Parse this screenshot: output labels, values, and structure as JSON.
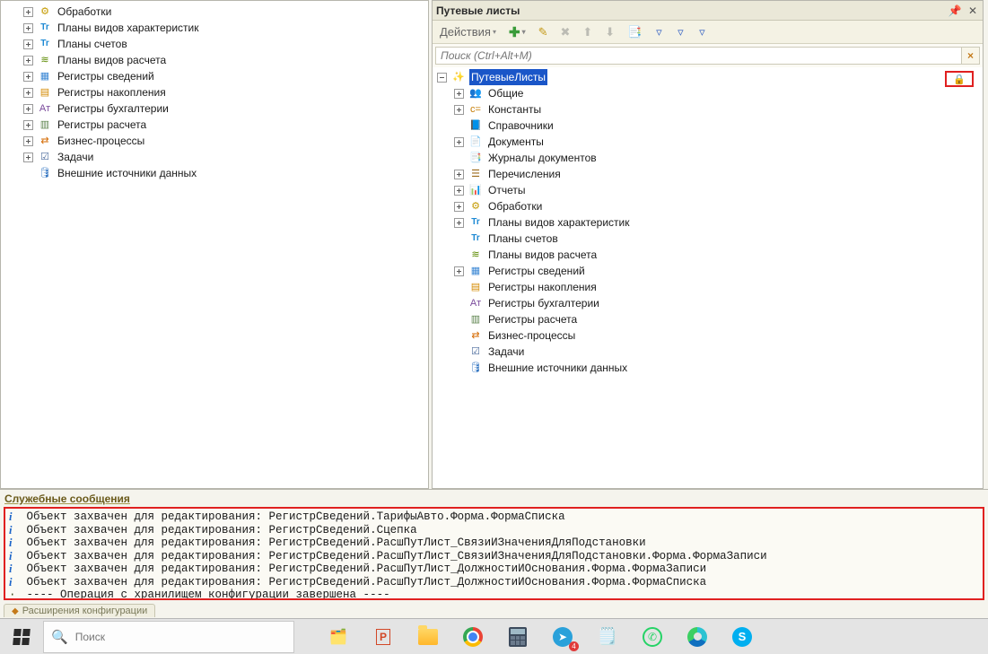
{
  "left_tree": [
    {
      "icon": "gear",
      "label": "Обработки",
      "exp": "plus"
    },
    {
      "icon": "tt",
      "label": "Планы видов характеристик",
      "exp": "plus"
    },
    {
      "icon": "tt",
      "label": "Планы счетов",
      "exp": "plus"
    },
    {
      "icon": "ar",
      "label": "Планы видов расчета",
      "exp": "plus"
    },
    {
      "icon": "cal",
      "label": "Регистры сведений",
      "exp": "plus"
    },
    {
      "icon": "reg",
      "label": "Регистры накопления",
      "exp": "plus"
    },
    {
      "icon": "at",
      "label": "Регистры бухгалтерии",
      "exp": "plus"
    },
    {
      "icon": "tab",
      "label": "Регистры расчета",
      "exp": "plus"
    },
    {
      "icon": "flow",
      "label": "Бизнес-процессы",
      "exp": "plus"
    },
    {
      "icon": "task",
      "label": "Задачи",
      "exp": "plus"
    },
    {
      "icon": "db",
      "label": "Внешние источники данных",
      "exp": "none"
    }
  ],
  "right_panel": {
    "title": "Путевые листы",
    "actions_label": "Действия",
    "search_placeholder": "Поиск (Ctrl+Alt+M)",
    "root_label": "ПутевыеЛисты",
    "lock_badge": "🔒",
    "children": [
      {
        "icon": "users",
        "label": "Общие",
        "exp": "plus",
        "indent": 1
      },
      {
        "icon": "cc",
        "label": "Константы",
        "exp": "plus",
        "indent": 1
      },
      {
        "icon": "book",
        "label": "Справочники",
        "exp": "none",
        "indent": 1
      },
      {
        "icon": "doc",
        "label": "Документы",
        "exp": "plus",
        "indent": 1
      },
      {
        "icon": "docs",
        "label": "Журналы документов",
        "exp": "none",
        "indent": 1
      },
      {
        "icon": "enum",
        "label": "Перечисления",
        "exp": "plus",
        "indent": 1
      },
      {
        "icon": "rep",
        "label": "Отчеты",
        "exp": "plus",
        "indent": 1
      },
      {
        "icon": "gear",
        "label": "Обработки",
        "exp": "plus",
        "indent": 1
      },
      {
        "icon": "tt",
        "label": "Планы видов характеристик",
        "exp": "plus",
        "indent": 1
      },
      {
        "icon": "tt",
        "label": "Планы счетов",
        "exp": "none",
        "indent": 1
      },
      {
        "icon": "ar",
        "label": "Планы видов расчета",
        "exp": "none",
        "indent": 1
      },
      {
        "icon": "cal",
        "label": "Регистры сведений",
        "exp": "plus",
        "indent": 1
      },
      {
        "icon": "reg",
        "label": "Регистры накопления",
        "exp": "none",
        "indent": 1
      },
      {
        "icon": "at",
        "label": "Регистры бухгалтерии",
        "exp": "none",
        "indent": 1
      },
      {
        "icon": "tab",
        "label": "Регистры расчета",
        "exp": "none",
        "indent": 1
      },
      {
        "icon": "flow",
        "label": "Бизнес-процессы",
        "exp": "none",
        "indent": 1
      },
      {
        "icon": "task",
        "label": "Задачи",
        "exp": "none",
        "indent": 1
      },
      {
        "icon": "db",
        "label": "Внешние источники данных",
        "exp": "none",
        "indent": 1
      }
    ]
  },
  "svc": {
    "title": "Служебные сообщения",
    "lines": [
      {
        "mark": "i",
        "text": "Объект захвачен для редактирования: РегистрСведений.ТарифыАвто.Форма.ФормаСписка"
      },
      {
        "mark": "i",
        "text": "Объект захвачен для редактирования: РегистрСведений.Сцепка"
      },
      {
        "mark": "i",
        "text": "Объект захвачен для редактирования: РегистрСведений.РасшПутЛист_СвязиИЗначенияДляПодстановки"
      },
      {
        "mark": "i",
        "text": "Объект захвачен для редактирования: РегистрСведений.РасшПутЛист_СвязиИЗначенияДляПодстановки.Форма.ФормаЗаписи"
      },
      {
        "mark": "i",
        "text": "Объект захвачен для редактирования: РегистрСведений.РасшПутЛист_ДолжностиИОснования.Форма.ФормаЗаписи"
      },
      {
        "mark": "i",
        "text": "Объект захвачен для редактирования: РегистрСведений.РасшПутЛист_ДолжностиИОснования.Форма.ФормаСписка"
      },
      {
        "mark": "dot",
        "text": "---- Операция с хранилищем конфигурации завершена ----"
      }
    ]
  },
  "doc_tab": "Расширения конфигурации",
  "taskbar": {
    "search": "Поиск",
    "tg_badge": "4"
  }
}
